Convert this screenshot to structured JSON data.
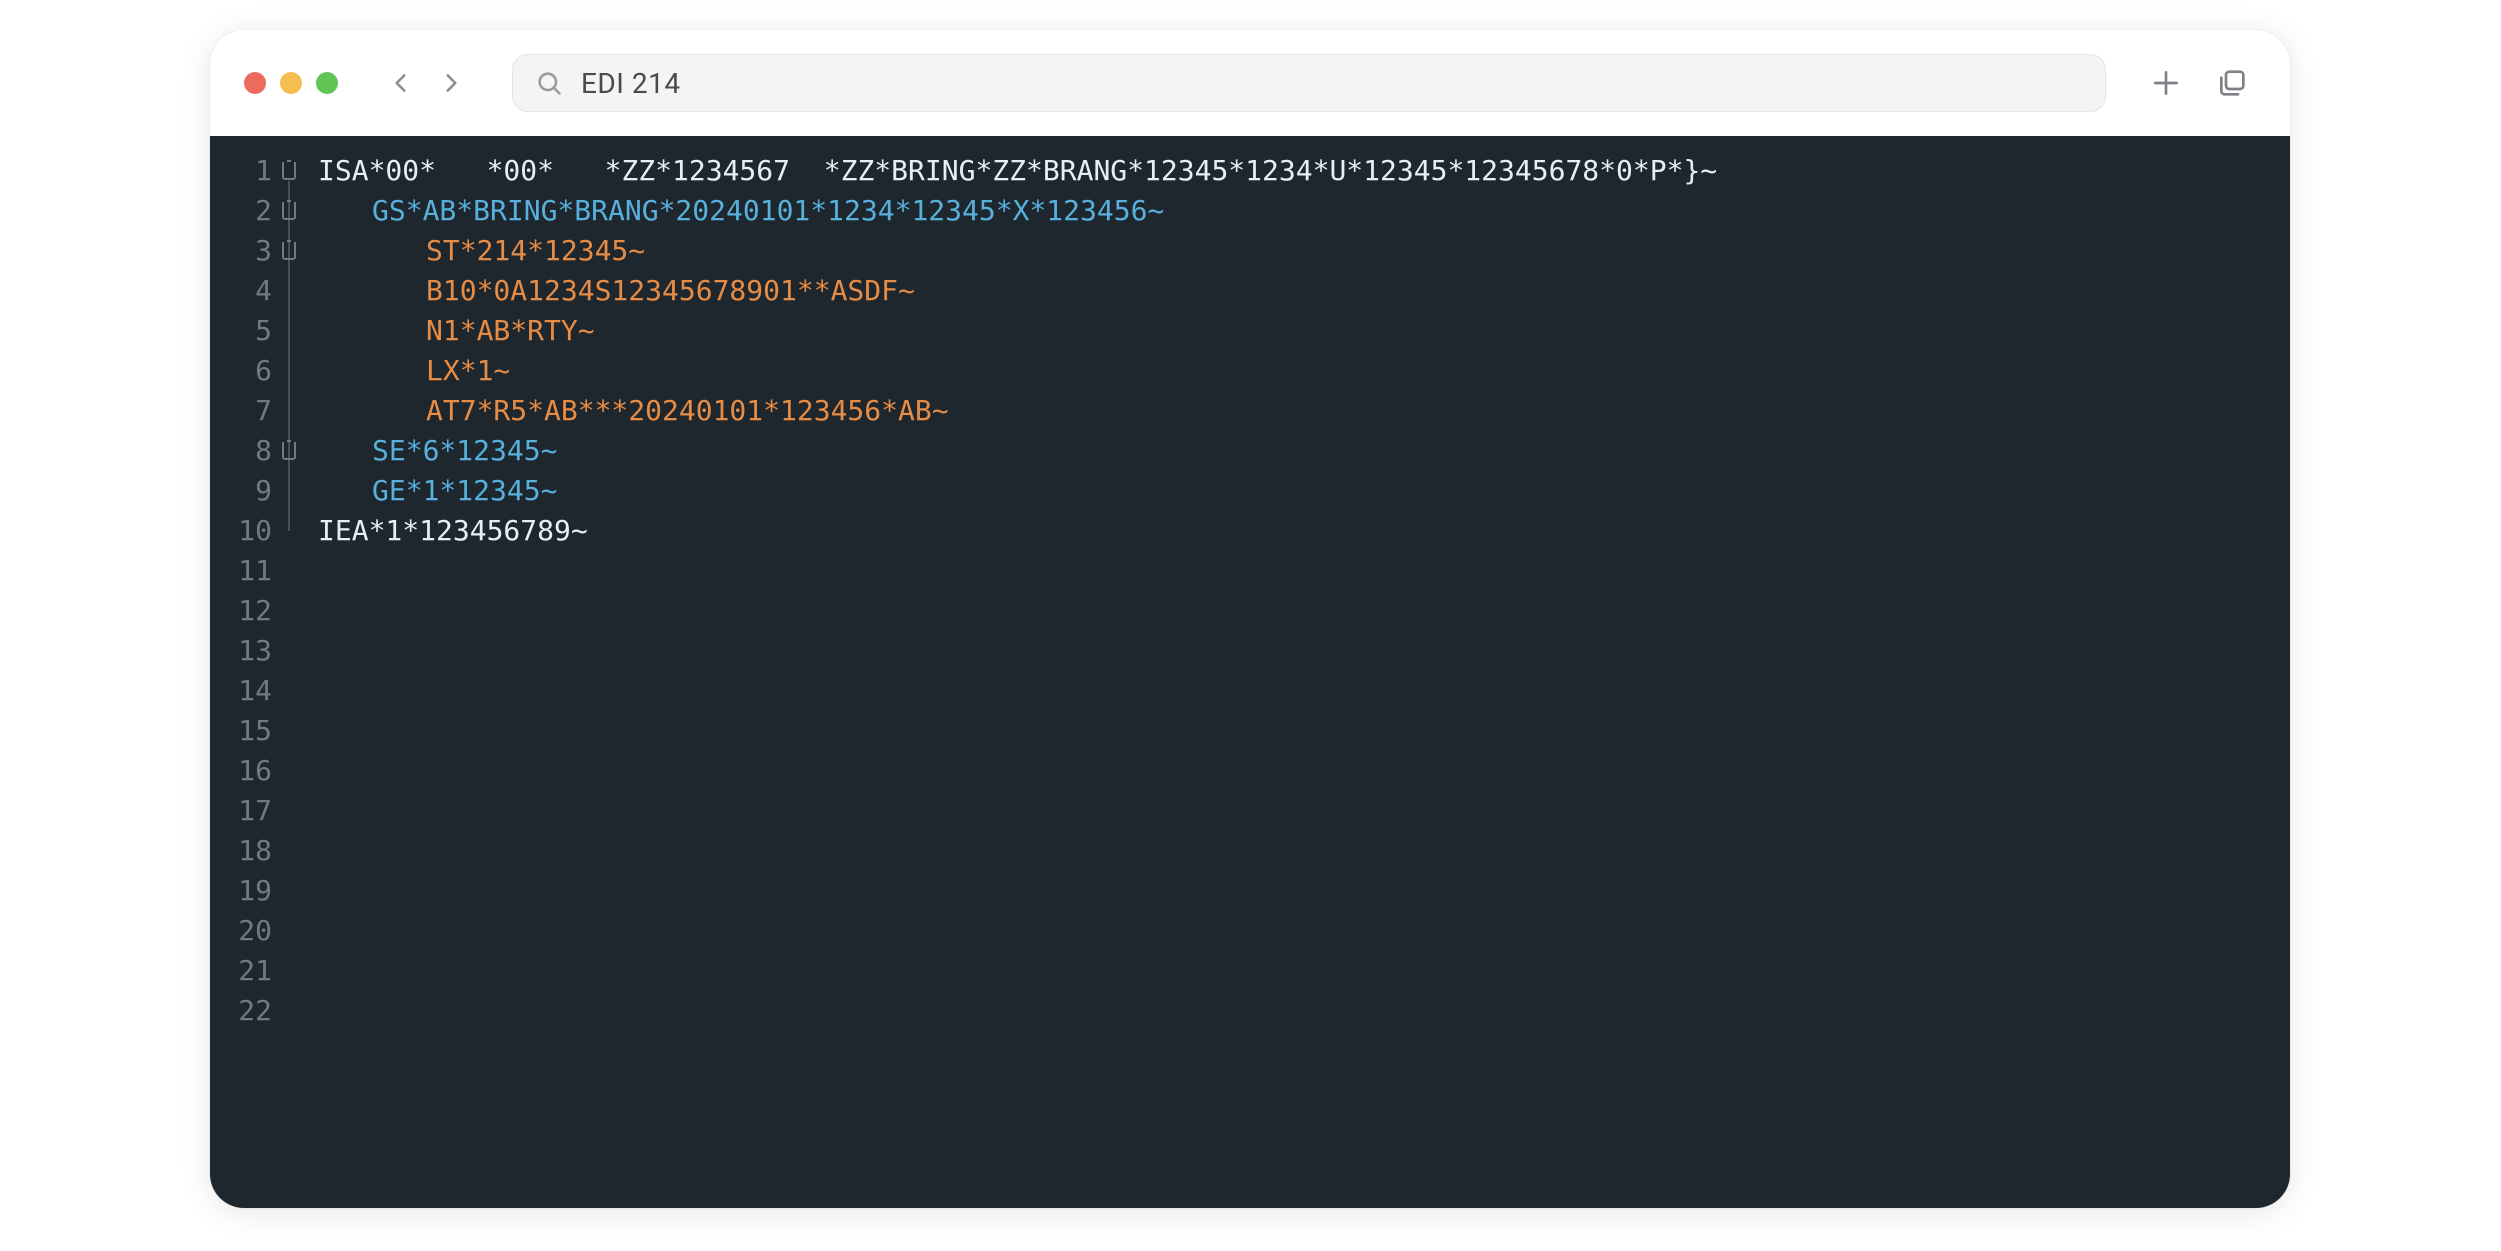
{
  "toolbar": {
    "search_value": "EDI 214"
  },
  "editor": {
    "total_lines": 22,
    "lines": [
      {
        "n": 1,
        "color": "white",
        "indent": 0,
        "fold": true,
        "text": "ISA*00*   *00*   *ZZ*1234567  *ZZ*BRING*ZZ*BRANG*12345*1234*U*12345*12345678*0*P*}~"
      },
      {
        "n": 2,
        "color": "blue",
        "indent": 1,
        "fold": true,
        "text": "GS*AB*BRING*BRANG*20240101*1234*12345*X*123456~"
      },
      {
        "n": 3,
        "color": "orange",
        "indent": 2,
        "fold": true,
        "text": "ST*214*12345~"
      },
      {
        "n": 4,
        "color": "orange",
        "indent": 2,
        "fold": false,
        "text": "B10*0A1234S12345678901**ASDF~"
      },
      {
        "n": 5,
        "color": "orange",
        "indent": 2,
        "fold": false,
        "text": "N1*AB*RTY~"
      },
      {
        "n": 6,
        "color": "orange",
        "indent": 2,
        "fold": false,
        "text": "LX*1~"
      },
      {
        "n": 7,
        "color": "orange",
        "indent": 2,
        "fold": false,
        "text": "AT7*R5*AB***20240101*123456*AB~"
      },
      {
        "n": 8,
        "color": "blue",
        "indent": 1,
        "fold": true,
        "text": "SE*6*12345~"
      },
      {
        "n": 9,
        "color": "blue",
        "indent": 1,
        "fold": false,
        "text": "GE*1*12345~"
      },
      {
        "n": 10,
        "color": "white",
        "indent": 0,
        "fold": false,
        "text": "IEA*1*123456789~"
      }
    ]
  }
}
